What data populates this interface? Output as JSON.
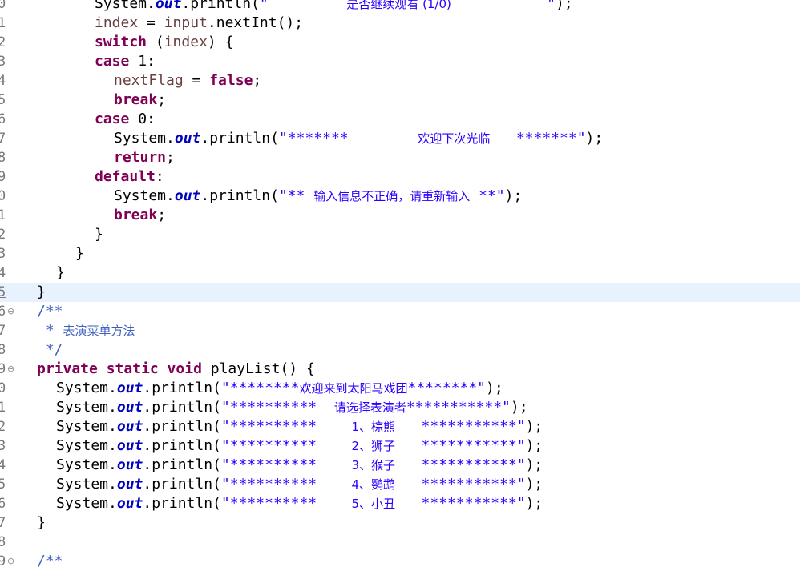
{
  "editor": {
    "lines": [
      {
        "n": "0",
        "fold": "",
        "current": false,
        "indent": 8,
        "t": [
          {
            "c": "pl",
            "s": "System."
          },
          {
            "c": "fld",
            "s": "out"
          },
          {
            "c": "pl",
            "s": ".println("
          },
          {
            "c": "str",
            "s": "\"         "
          },
          {
            "c": "str cjk",
            "s": "是否继续观看 (1/0)"
          },
          {
            "c": "str",
            "s": "           \""
          },
          {
            "c": "pl",
            "s": ");"
          }
        ]
      },
      {
        "n": "1",
        "fold": "",
        "current": false,
        "indent": 8,
        "t": [
          {
            "c": "var",
            "s": "index"
          },
          {
            "c": "pl",
            "s": " = "
          },
          {
            "c": "var",
            "s": "input"
          },
          {
            "c": "pl",
            "s": ".nextInt();"
          }
        ]
      },
      {
        "n": "2",
        "fold": "",
        "current": false,
        "indent": 8,
        "t": [
          {
            "c": "kw",
            "s": "switch"
          },
          {
            "c": "pl",
            "s": " ("
          },
          {
            "c": "var",
            "s": "index"
          },
          {
            "c": "pl",
            "s": ") {"
          }
        ]
      },
      {
        "n": "3",
        "fold": "",
        "current": false,
        "indent": 8,
        "t": [
          {
            "c": "kw",
            "s": "case"
          },
          {
            "c": "pl",
            "s": " 1:"
          }
        ]
      },
      {
        "n": "4",
        "fold": "",
        "current": false,
        "indent": 10,
        "t": [
          {
            "c": "var",
            "s": "nextFlag"
          },
          {
            "c": "pl",
            "s": " = "
          },
          {
            "c": "kw",
            "s": "false"
          },
          {
            "c": "pl",
            "s": ";"
          }
        ]
      },
      {
        "n": "5",
        "fold": "",
        "current": false,
        "indent": 10,
        "t": [
          {
            "c": "kw",
            "s": "break"
          },
          {
            "c": "pl",
            "s": ";"
          }
        ]
      },
      {
        "n": "6",
        "fold": "",
        "current": false,
        "indent": 8,
        "t": [
          {
            "c": "kw",
            "s": "case"
          },
          {
            "c": "pl",
            "s": " 0:"
          }
        ]
      },
      {
        "n": "7",
        "fold": "",
        "current": false,
        "indent": 10,
        "t": [
          {
            "c": "pl",
            "s": "System."
          },
          {
            "c": "fld",
            "s": "out"
          },
          {
            "c": "pl",
            "s": ".println("
          },
          {
            "c": "str",
            "s": "\"*******        "
          },
          {
            "c": "str cjk",
            "s": "欢迎下次光临"
          },
          {
            "c": "str",
            "s": "   *******\""
          },
          {
            "c": "pl",
            "s": ");"
          }
        ]
      },
      {
        "n": "8",
        "fold": "",
        "current": false,
        "indent": 10,
        "t": [
          {
            "c": "kw",
            "s": "return"
          },
          {
            "c": "pl",
            "s": ";"
          }
        ]
      },
      {
        "n": "9",
        "fold": "",
        "current": false,
        "indent": 8,
        "t": [
          {
            "c": "kw",
            "s": "default"
          },
          {
            "c": "pl",
            "s": ":"
          }
        ]
      },
      {
        "n": "0",
        "fold": "",
        "current": false,
        "indent": 10,
        "t": [
          {
            "c": "pl",
            "s": "System."
          },
          {
            "c": "fld",
            "s": "out"
          },
          {
            "c": "pl",
            "s": ".println("
          },
          {
            "c": "str",
            "s": "\"** "
          },
          {
            "c": "str cjk",
            "s": "输入信息不正确，请重新输入"
          },
          {
            "c": "str",
            "s": " **\""
          },
          {
            "c": "pl",
            "s": ");"
          }
        ]
      },
      {
        "n": "1",
        "fold": "",
        "current": false,
        "indent": 10,
        "t": [
          {
            "c": "kw",
            "s": "break"
          },
          {
            "c": "pl",
            "s": ";"
          }
        ]
      },
      {
        "n": "2",
        "fold": "",
        "current": false,
        "indent": 8,
        "t": [
          {
            "c": "pl",
            "s": "}"
          }
        ]
      },
      {
        "n": "3",
        "fold": "",
        "current": false,
        "indent": 6,
        "t": [
          {
            "c": "pl",
            "s": "}"
          }
        ]
      },
      {
        "n": "4",
        "fold": "",
        "current": false,
        "indent": 4,
        "t": [
          {
            "c": "pl",
            "s": "}"
          }
        ]
      },
      {
        "n": "5",
        "fold": "",
        "current": true,
        "indent": 2,
        "t": [
          {
            "c": "pl",
            "s": "}"
          }
        ]
      },
      {
        "n": "6",
        "fold": "⊖",
        "current": false,
        "indent": 2,
        "t": [
          {
            "c": "cm",
            "s": "/**"
          }
        ]
      },
      {
        "n": "7",
        "fold": "",
        "current": false,
        "indent": 2,
        "t": [
          {
            "c": "cm",
            "s": " * "
          },
          {
            "c": "cjkc",
            "s": "表演菜单方法"
          }
        ]
      },
      {
        "n": "8",
        "fold": "",
        "current": false,
        "indent": 2,
        "t": [
          {
            "c": "cm",
            "s": " */"
          }
        ]
      },
      {
        "n": "9",
        "fold": "⊖",
        "current": false,
        "indent": 2,
        "t": [
          {
            "c": "kw",
            "s": "private static void"
          },
          {
            "c": "pl",
            "s": " playList() {"
          }
        ]
      },
      {
        "n": "0",
        "fold": "",
        "current": false,
        "indent": 4,
        "t": [
          {
            "c": "pl",
            "s": "System."
          },
          {
            "c": "fld",
            "s": "out"
          },
          {
            "c": "pl",
            "s": ".println("
          },
          {
            "c": "str",
            "s": "\"********"
          },
          {
            "c": "str cjk",
            "s": "欢迎来到太阳马戏团"
          },
          {
            "c": "str",
            "s": "********\""
          },
          {
            "c": "pl",
            "s": ");"
          }
        ]
      },
      {
        "n": "1",
        "fold": "",
        "current": false,
        "indent": 4,
        "t": [
          {
            "c": "pl",
            "s": "System."
          },
          {
            "c": "fld",
            "s": "out"
          },
          {
            "c": "pl",
            "s": ".println("
          },
          {
            "c": "str",
            "s": "\"**********  "
          },
          {
            "c": "str cjk",
            "s": "请选择表演者"
          },
          {
            "c": "str",
            "s": "***********\""
          },
          {
            "c": "pl",
            "s": ");"
          }
        ]
      },
      {
        "n": "2",
        "fold": "",
        "current": false,
        "indent": 4,
        "t": [
          {
            "c": "pl",
            "s": "System."
          },
          {
            "c": "fld",
            "s": "out"
          },
          {
            "c": "pl",
            "s": ".println("
          },
          {
            "c": "str",
            "s": "\"**********    "
          },
          {
            "c": "str cjk",
            "s": "1、棕熊"
          },
          {
            "c": "str",
            "s": "   ***********\""
          },
          {
            "c": "pl",
            "s": ");"
          }
        ]
      },
      {
        "n": "3",
        "fold": "",
        "current": false,
        "indent": 4,
        "t": [
          {
            "c": "pl",
            "s": "System."
          },
          {
            "c": "fld",
            "s": "out"
          },
          {
            "c": "pl",
            "s": ".println("
          },
          {
            "c": "str",
            "s": "\"**********    "
          },
          {
            "c": "str cjk",
            "s": "2、狮子"
          },
          {
            "c": "str",
            "s": "   ***********\""
          },
          {
            "c": "pl",
            "s": ");"
          }
        ]
      },
      {
        "n": "4",
        "fold": "",
        "current": false,
        "indent": 4,
        "t": [
          {
            "c": "pl",
            "s": "System."
          },
          {
            "c": "fld",
            "s": "out"
          },
          {
            "c": "pl",
            "s": ".println("
          },
          {
            "c": "str",
            "s": "\"**********    "
          },
          {
            "c": "str cjk",
            "s": "3、猴子"
          },
          {
            "c": "str",
            "s": "   ***********\""
          },
          {
            "c": "pl",
            "s": ");"
          }
        ]
      },
      {
        "n": "5",
        "fold": "",
        "current": false,
        "indent": 4,
        "t": [
          {
            "c": "pl",
            "s": "System."
          },
          {
            "c": "fld",
            "s": "out"
          },
          {
            "c": "pl",
            "s": ".println("
          },
          {
            "c": "str",
            "s": "\"**********    "
          },
          {
            "c": "str cjk",
            "s": "4、鹦鹉"
          },
          {
            "c": "str",
            "s": "   ***********\""
          },
          {
            "c": "pl",
            "s": ");"
          }
        ]
      },
      {
        "n": "6",
        "fold": "",
        "current": false,
        "indent": 4,
        "t": [
          {
            "c": "pl",
            "s": "System."
          },
          {
            "c": "fld",
            "s": "out"
          },
          {
            "c": "pl",
            "s": ".println("
          },
          {
            "c": "str",
            "s": "\"**********    "
          },
          {
            "c": "str cjk",
            "s": "5、小丑"
          },
          {
            "c": "str",
            "s": "   ***********\""
          },
          {
            "c": "pl",
            "s": ");"
          }
        ]
      },
      {
        "n": "7",
        "fold": "",
        "current": false,
        "indent": 2,
        "t": [
          {
            "c": "pl",
            "s": "}"
          }
        ]
      },
      {
        "n": "8",
        "fold": "",
        "current": false,
        "indent": 0,
        "t": []
      },
      {
        "n": "9",
        "fold": "⊖",
        "current": false,
        "indent": 2,
        "t": [
          {
            "c": "cm",
            "s": "/**"
          }
        ]
      }
    ]
  }
}
